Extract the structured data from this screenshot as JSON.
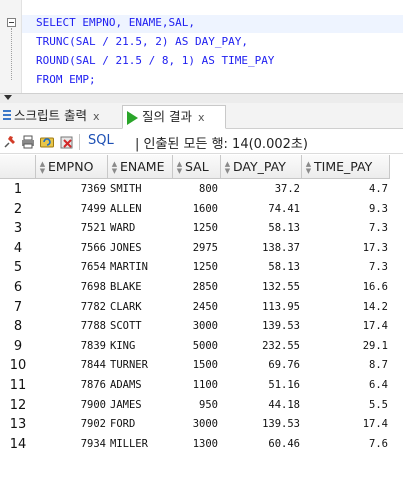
{
  "editor": {
    "lines": [
      [
        [
          "kw",
          "SELECT "
        ],
        [
          "id",
          "EMPNO, ENAME,SAL,"
        ]
      ],
      [
        [
          "fn",
          "TRUNC"
        ],
        [
          "id",
          "(SAL / 21.5, 2) "
        ],
        [
          "kw",
          "AS "
        ],
        [
          "id",
          "DAY_PAY,"
        ]
      ],
      [
        [
          "fn",
          "ROUND"
        ],
        [
          "id",
          "(SAL / 21.5 / 8, 1) "
        ],
        [
          "kw",
          "AS "
        ],
        [
          "id",
          "TIME_PAY"
        ]
      ],
      [
        [
          "kw",
          "FROM "
        ],
        [
          "id",
          "EMP;"
        ]
      ]
    ]
  },
  "tabs": {
    "script_label": "스크립트 출력",
    "result_label": "질의 결과",
    "close_glyph": "x"
  },
  "toolbar": {
    "sql_label": "SQL",
    "status": "| 인출된 모든 행: 14(0.002초)"
  },
  "grid": {
    "columns": [
      "EMPNO",
      "ENAME",
      "SAL",
      "DAY_PAY",
      "TIME_PAY"
    ],
    "rows": [
      [
        "1",
        "7369",
        "SMITH",
        "800",
        "37.2",
        "4.7"
      ],
      [
        "2",
        "7499",
        "ALLEN",
        "1600",
        "74.41",
        "9.3"
      ],
      [
        "3",
        "7521",
        "WARD",
        "1250",
        "58.13",
        "7.3"
      ],
      [
        "4",
        "7566",
        "JONES",
        "2975",
        "138.37",
        "17.3"
      ],
      [
        "5",
        "7654",
        "MARTIN",
        "1250",
        "58.13",
        "7.3"
      ],
      [
        "6",
        "7698",
        "BLAKE",
        "2850",
        "132.55",
        "16.6"
      ],
      [
        "7",
        "7782",
        "CLARK",
        "2450",
        "113.95",
        "14.2"
      ],
      [
        "8",
        "7788",
        "SCOTT",
        "3000",
        "139.53",
        "17.4"
      ],
      [
        "9",
        "7839",
        "KING",
        "5000",
        "232.55",
        "29.1"
      ],
      [
        "10",
        "7844",
        "TURNER",
        "1500",
        "69.76",
        "8.7"
      ],
      [
        "11",
        "7876",
        "ADAMS",
        "1100",
        "51.16",
        "6.4"
      ],
      [
        "12",
        "7900",
        "JAMES",
        "950",
        "44.18",
        "5.5"
      ],
      [
        "13",
        "7902",
        "FORD",
        "3000",
        "139.53",
        "17.4"
      ],
      [
        "14",
        "7934",
        "MILLER",
        "1300",
        "60.46",
        "7.6"
      ]
    ]
  },
  "colors": {
    "keyword": "#1e1ef0",
    "identifier": "#1e1ef0",
    "function": "#1e1ef0",
    "play_icon": "#2aa52a",
    "sql_label": "#1e50b4"
  },
  "icons": [
    "fold-icon",
    "script-output-icon",
    "run-result-icon",
    "pin-icon",
    "print-icon",
    "refresh-icon",
    "cancel-icon"
  ]
}
